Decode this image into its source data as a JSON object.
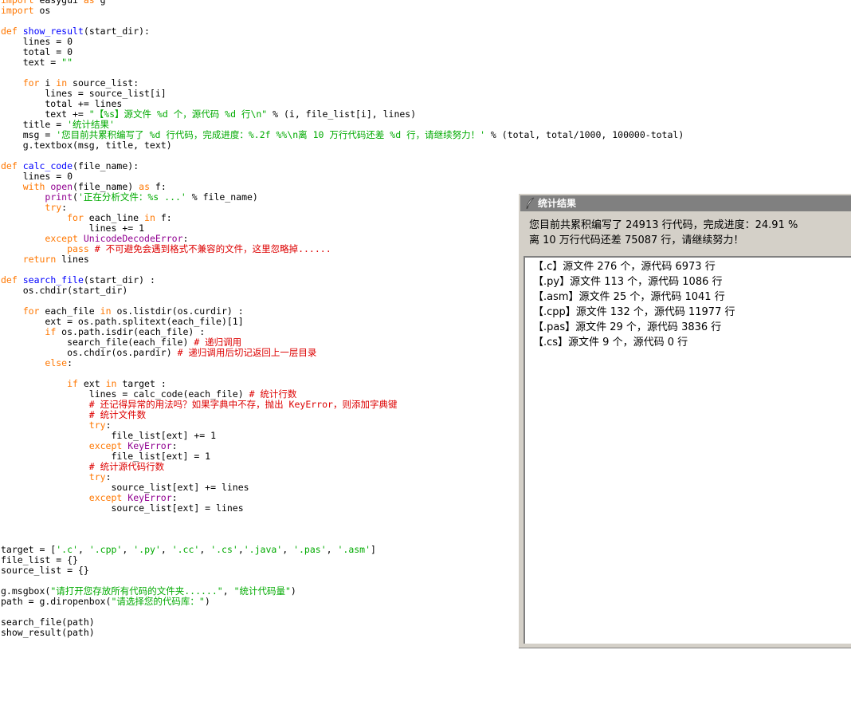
{
  "code_lines": [
    [
      {
        "t": "import",
        "c": "kw"
      },
      {
        "t": " easygui "
      },
      {
        "t": "as",
        "c": "kw"
      },
      {
        "t": " g"
      }
    ],
    [
      {
        "t": "import",
        "c": "kw"
      },
      {
        "t": " os"
      }
    ],
    [],
    [
      {
        "t": "def",
        "c": "kw"
      },
      {
        "t": " "
      },
      {
        "t": "show_result",
        "c": "fn"
      },
      {
        "t": "(start_dir):"
      }
    ],
    [
      {
        "t": "    lines = 0"
      }
    ],
    [
      {
        "t": "    total = 0"
      }
    ],
    [
      {
        "t": "    text = "
      },
      {
        "t": "\"\"",
        "c": "st"
      }
    ],
    [],
    [
      {
        "t": "    "
      },
      {
        "t": "for",
        "c": "kw"
      },
      {
        "t": " i "
      },
      {
        "t": "in",
        "c": "kw"
      },
      {
        "t": " source_list:"
      }
    ],
    [
      {
        "t": "        lines = source_list[i]"
      }
    ],
    [
      {
        "t": "        total += lines"
      }
    ],
    [
      {
        "t": "        text += "
      },
      {
        "t": "\"【%s】源文件 %d 个，源代码 %d 行\\n\"",
        "c": "st"
      },
      {
        "t": " % (i, file_list[i], lines)"
      }
    ],
    [
      {
        "t": "    title = "
      },
      {
        "t": "'统计结果'",
        "c": "st"
      }
    ],
    [
      {
        "t": "    msg = "
      },
      {
        "t": "'您目前共累积编写了 %d 行代码，完成进度：%.2f %%\\n离 10 万行代码还差 %d 行，请继续努力！'",
        "c": "st"
      },
      {
        "t": " % (total, total/1000, 100000-total)"
      }
    ],
    [
      {
        "t": "    g.textbox(msg, title, text)"
      }
    ],
    [],
    [
      {
        "t": "def",
        "c": "kw"
      },
      {
        "t": " "
      },
      {
        "t": "calc_code",
        "c": "fn"
      },
      {
        "t": "(file_name):"
      }
    ],
    [
      {
        "t": "    lines = 0"
      }
    ],
    [
      {
        "t": "    "
      },
      {
        "t": "with",
        "c": "kw"
      },
      {
        "t": " "
      },
      {
        "t": "open",
        "c": "bi"
      },
      {
        "t": "(file_name) "
      },
      {
        "t": "as",
        "c": "kw"
      },
      {
        "t": " f:"
      }
    ],
    [
      {
        "t": "        "
      },
      {
        "t": "print",
        "c": "bi"
      },
      {
        "t": "("
      },
      {
        "t": "'正在分析文件：%s ...'",
        "c": "st"
      },
      {
        "t": " % file_name)"
      }
    ],
    [
      {
        "t": "        "
      },
      {
        "t": "try",
        "c": "kw"
      },
      {
        "t": ":"
      }
    ],
    [
      {
        "t": "            "
      },
      {
        "t": "for",
        "c": "kw"
      },
      {
        "t": " each_line "
      },
      {
        "t": "in",
        "c": "kw"
      },
      {
        "t": " f:"
      }
    ],
    [
      {
        "t": "                lines += 1"
      }
    ],
    [
      {
        "t": "        "
      },
      {
        "t": "except",
        "c": "kw"
      },
      {
        "t": " "
      },
      {
        "t": "UnicodeDecodeError",
        "c": "bi"
      },
      {
        "t": ":"
      }
    ],
    [
      {
        "t": "            "
      },
      {
        "t": "pass",
        "c": "kw"
      },
      {
        "t": " "
      },
      {
        "t": "# 不可避免会遇到格式不兼容的文件，这里忽略掉......",
        "c": "cm"
      }
    ],
    [
      {
        "t": "    "
      },
      {
        "t": "return",
        "c": "kw"
      },
      {
        "t": " lines"
      }
    ],
    [],
    [
      {
        "t": "def",
        "c": "kw"
      },
      {
        "t": " "
      },
      {
        "t": "search_file",
        "c": "fn"
      },
      {
        "t": "(start_dir) :"
      }
    ],
    [
      {
        "t": "    os.chdir(start_dir)"
      }
    ],
    [],
    [
      {
        "t": "    "
      },
      {
        "t": "for",
        "c": "kw"
      },
      {
        "t": " each_file "
      },
      {
        "t": "in",
        "c": "kw"
      },
      {
        "t": " os.listdir(os.curdir) :"
      }
    ],
    [
      {
        "t": "        ext = os.path.splitext(each_file)[1]"
      }
    ],
    [
      {
        "t": "        "
      },
      {
        "t": "if",
        "c": "kw"
      },
      {
        "t": " os.path.isdir(each_file) :"
      }
    ],
    [
      {
        "t": "            search_file(each_file) "
      },
      {
        "t": "# 递归调用",
        "c": "cm"
      }
    ],
    [
      {
        "t": "            os.chdir(os.pardir) "
      },
      {
        "t": "# 递归调用后切记返回上一层目录",
        "c": "cm"
      }
    ],
    [
      {
        "t": "        "
      },
      {
        "t": "else",
        "c": "kw"
      },
      {
        "t": ":"
      }
    ],
    [],
    [
      {
        "t": "            "
      },
      {
        "t": "if",
        "c": "kw"
      },
      {
        "t": " ext "
      },
      {
        "t": "in",
        "c": "kw"
      },
      {
        "t": " target :"
      }
    ],
    [
      {
        "t": "                lines = calc_code(each_file) "
      },
      {
        "t": "# 统计行数",
        "c": "cm"
      }
    ],
    [
      {
        "t": "                "
      },
      {
        "t": "# 还记得异常的用法吗？如果字典中不存，抛出 KeyError，则添加字典键",
        "c": "cm"
      }
    ],
    [
      {
        "t": "                "
      },
      {
        "t": "# 统计文件数",
        "c": "cm"
      }
    ],
    [
      {
        "t": "                "
      },
      {
        "t": "try",
        "c": "kw"
      },
      {
        "t": ":"
      }
    ],
    [
      {
        "t": "                    file_list[ext] += 1"
      }
    ],
    [
      {
        "t": "                "
      },
      {
        "t": "except",
        "c": "kw"
      },
      {
        "t": " "
      },
      {
        "t": "KeyError",
        "c": "bi"
      },
      {
        "t": ":"
      }
    ],
    [
      {
        "t": "                    file_list[ext] = 1"
      }
    ],
    [
      {
        "t": "                "
      },
      {
        "t": "# 统计源代码行数",
        "c": "cm"
      }
    ],
    [
      {
        "t": "                "
      },
      {
        "t": "try",
        "c": "kw"
      },
      {
        "t": ":"
      }
    ],
    [
      {
        "t": "                    source_list[ext] += lines"
      }
    ],
    [
      {
        "t": "                "
      },
      {
        "t": "except",
        "c": "kw"
      },
      {
        "t": " "
      },
      {
        "t": "KeyError",
        "c": "bi"
      },
      {
        "t": ":"
      }
    ],
    [
      {
        "t": "                    source_list[ext] = lines"
      }
    ],
    [],
    [],
    [],
    [
      {
        "t": "target = ["
      },
      {
        "t": "'.c'",
        "c": "st"
      },
      {
        "t": ", "
      },
      {
        "t": "'.cpp'",
        "c": "st"
      },
      {
        "t": ", "
      },
      {
        "t": "'.py'",
        "c": "st"
      },
      {
        "t": ", "
      },
      {
        "t": "'.cc'",
        "c": "st"
      },
      {
        "t": ", "
      },
      {
        "t": "'.cs'",
        "c": "st"
      },
      {
        "t": ","
      },
      {
        "t": "'.java'",
        "c": "st"
      },
      {
        "t": ", "
      },
      {
        "t": "'.pas'",
        "c": "st"
      },
      {
        "t": ", "
      },
      {
        "t": "'.asm'",
        "c": "st"
      },
      {
        "t": "]"
      }
    ],
    [
      {
        "t": "file_list = {}"
      }
    ],
    [
      {
        "t": "source_list = {}"
      }
    ],
    [],
    [
      {
        "t": "g.msgbox("
      },
      {
        "t": "\"请打开您存放所有代码的文件夹......\"",
        "c": "st"
      },
      {
        "t": ", "
      },
      {
        "t": "\"统计代码量\"",
        "c": "st"
      },
      {
        "t": ")"
      }
    ],
    [
      {
        "t": "path = g.diropenbox("
      },
      {
        "t": "\"请选择您的代码库：\"",
        "c": "st"
      },
      {
        "t": ")"
      }
    ],
    [],
    [
      {
        "t": "search_file(path)"
      }
    ],
    [
      {
        "t": "show_result(path)"
      }
    ]
  ],
  "dialog": {
    "title": "统计结果",
    "message_line1": "您目前共累积编写了 24913 行代码，完成进度：24.91 %",
    "message_line2": "离 10 万行代码还差 75087 行，请继续努力！",
    "textbox_lines": [
      "【.c】源文件 276 个，源代码 6973 行",
      "【.py】源文件 113 个，源代码 1086 行",
      "【.asm】源文件 25 个，源代码 1041 行",
      "【.cpp】源文件 132 个，源代码 11977 行",
      "【.pas】源文件 29 个，源代码 3836 行",
      "【.cs】源文件 9 个，源代码 0 行"
    ],
    "icon": "feather-icon"
  }
}
